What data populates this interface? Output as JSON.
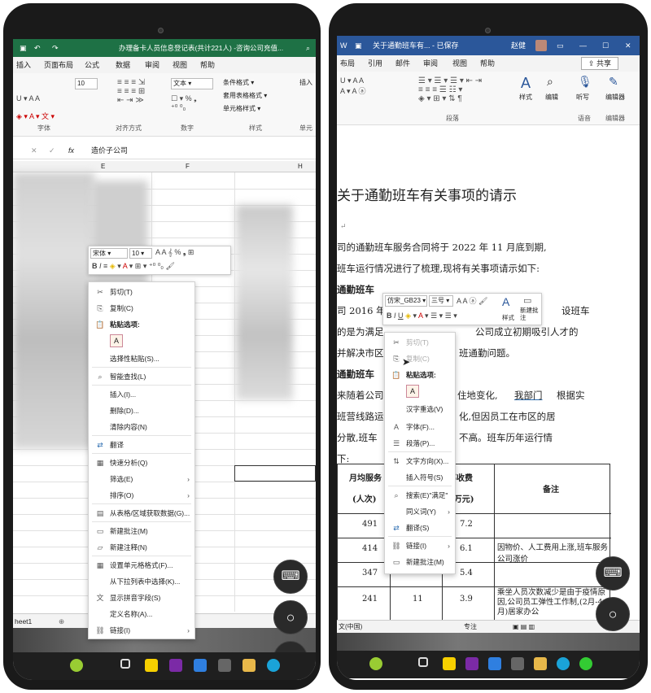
{
  "left": {
    "title": "办理备卡人员信息登记表(共计221人) -咨询公司充值...",
    "menu": [
      "插入",
      "页面布局",
      "公式",
      "数据",
      "审阅",
      "视图",
      "帮助"
    ],
    "font_size": "10",
    "number_format": "文本",
    "styles": [
      "条件格式",
      "套用表格格式",
      "单元格样式"
    ],
    "insert_label": "插入",
    "group_labels": [
      "字体",
      "对齐方式",
      "数字",
      "样式",
      "单元"
    ],
    "formula_fx": "fx",
    "formula_value": "造价子公司",
    "columns": [
      "E",
      "F",
      "H"
    ],
    "sheet_tab": "heet1",
    "mini_font": "宋体",
    "mini_size": "10",
    "context_menu": {
      "cut": "剪切(T)",
      "copy": "复制(C)",
      "paste_options": "粘贴选项:",
      "paste_special": "选择性粘贴(S)...",
      "smart_lookup": "智能查找(L)",
      "insert": "插入(I)...",
      "delete": "删除(D)...",
      "clear": "清除内容(N)",
      "translate": "翻译",
      "quick_analysis": "快速分析(Q)",
      "filter": "筛选(E)",
      "sort": "排序(O)",
      "get_data": "从表格/区域获取数据(G)...",
      "new_comment": "新建批注(M)",
      "new_note": "新建注释(N)",
      "format_cells": "设置单元格格式(F)...",
      "pick_list": "从下拉列表中选择(K)...",
      "phonetic": "显示拼音字段(S)",
      "define_name": "定义名称(A)...",
      "link": "链接(I)"
    }
  },
  "right": {
    "title": "关于通勤班车有... - 已保存",
    "user": "赵健",
    "menu": [
      "布局",
      "引用",
      "邮件",
      "审阅",
      "视图",
      "帮助"
    ],
    "share": "共享",
    "ribbon_labels": {
      "styles": "样式",
      "editing": "编辑",
      "dictate": "听写",
      "editor": "编辑器",
      "paragraph": "段落",
      "voice": "语音",
      "editor_group": "编辑器"
    },
    "doc_title": "关于通勤班车有关事项的请示",
    "paragraphs": [
      "司的通勤班车服务合同将于 2022 年 11 月底到期,",
      "班车运行情况进行了梳理,现将有关事项请示如下:",
      "通勤班车",
      "司 2016 年",
      "设班车",
      "的是为满足",
      "公司成立初期吸引人才的",
      "并解决市区",
      "班通勤问题。",
      "通勤班车",
      "来随着公司",
      "住地变化,",
      "我部门",
      "根据实",
      "班营线路运",
      "化,但因员工在市区的居",
      "分散,班车",
      "不高。班车历年运行情",
      "下:"
    ],
    "mini_font": "仿宋_GB23",
    "mini_size": "三号",
    "mini_styles": "样式",
    "mini_comment": "新建批注",
    "table_headers": [
      "月均服务",
      "(人次)",
      "部收费",
      "(万元)",
      "备注"
    ],
    "table_rows": [
      {
        "a": "491",
        "b": "",
        "c": "7.2",
        "note": ""
      },
      {
        "a": "414",
        "b": "",
        "c": "6.1",
        "note": "因物价、人工费用上涨,班车服务公司涨价"
      },
      {
        "a": "347",
        "b": "",
        "c": "5.4",
        "note": ""
      },
      {
        "a": "241",
        "b": "11",
        "c": "3.9",
        "note": "乘坐人员次数减少是由于疫情原因,公司员工弹性工作制,(2月-4月)居家办公"
      }
    ],
    "status_lang": "文(中国)",
    "status_focus": "专注",
    "context_menu": {
      "cut": "剪切(T)",
      "copy": "复制(C)",
      "paste_options": "粘贴选项:",
      "han_reconvert": "汉字重选(V)",
      "font": "字体(F)...",
      "paragraph": "段落(P)...",
      "text_direction": "文字方向(X)...",
      "insert_symbol": "插入符号(S)",
      "search": "搜索(E)\"满足\"",
      "synonyms": "同义词(Y)",
      "translate": "翻译(S)",
      "link": "链接(I)",
      "new_comment": "新建批注(M)"
    }
  }
}
